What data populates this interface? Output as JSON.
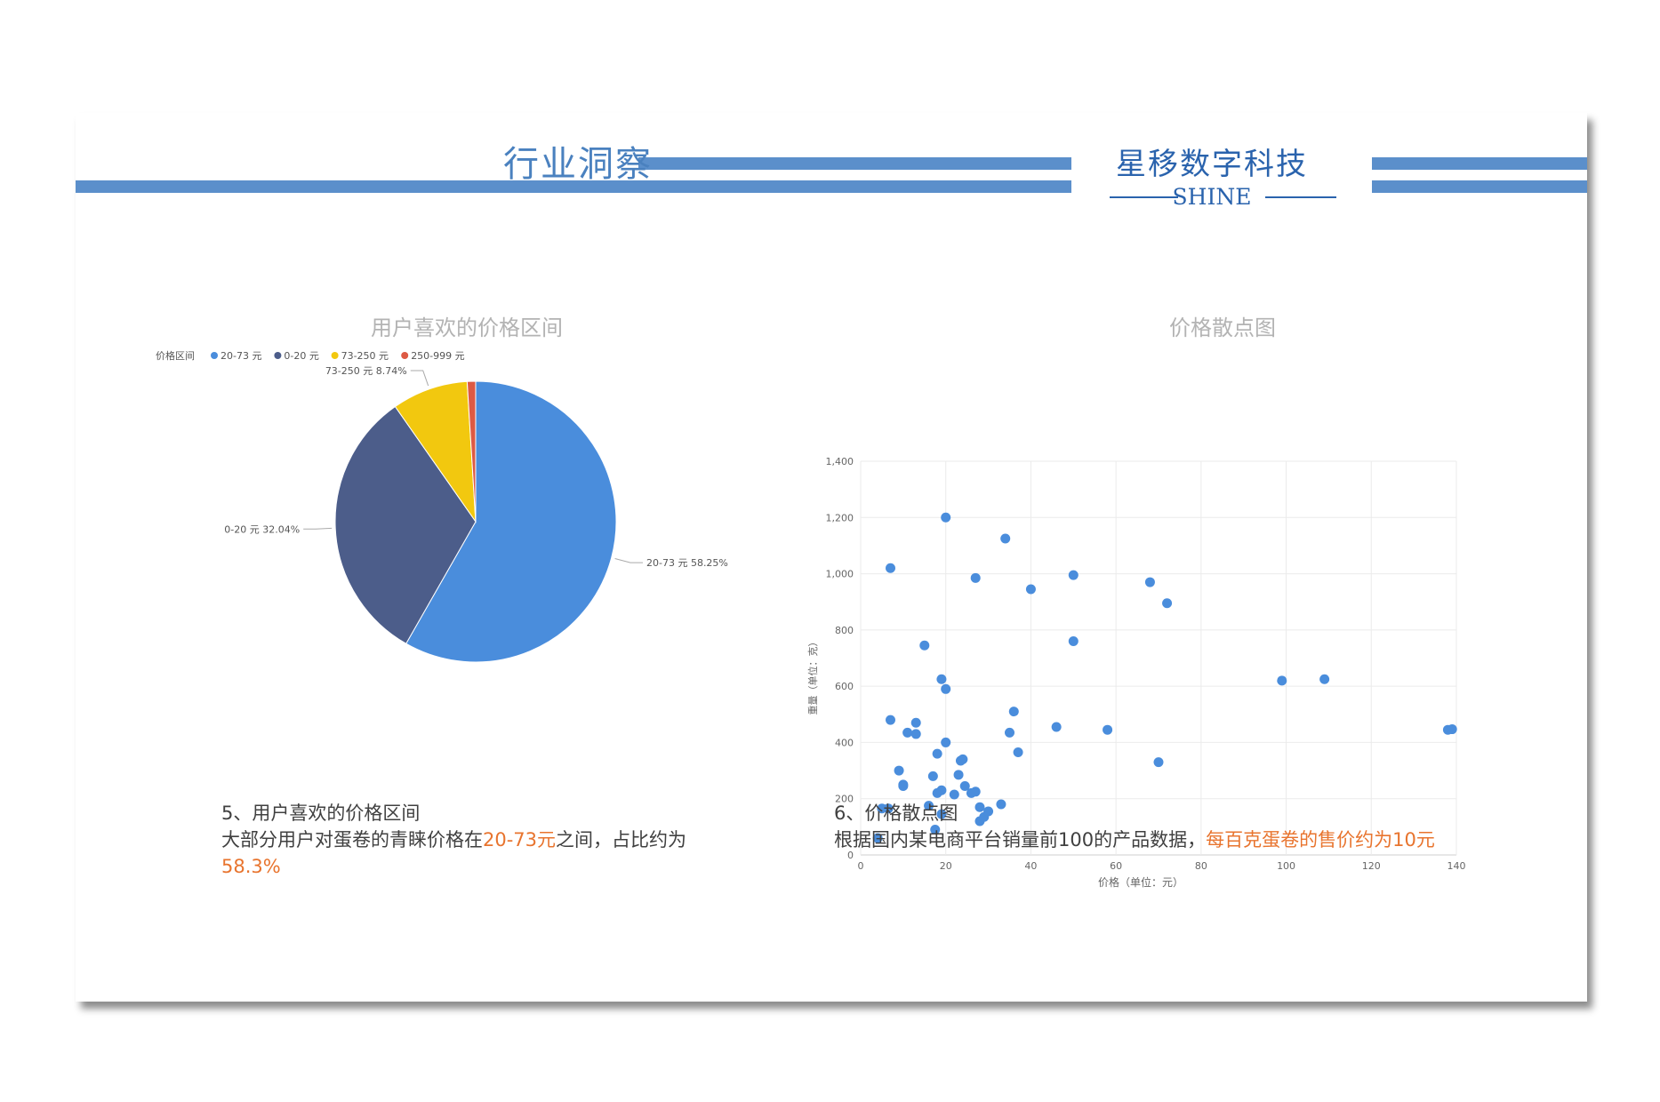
{
  "header": {
    "title": "行业洞察",
    "brand_name": "星移数字科技",
    "brand_sub": "SHINE",
    "accent_color": "#5b8fcb"
  },
  "left_panel": {
    "caption_title": "5、用户喜欢的价格区间",
    "caption_text_1": "大部分用户对蛋卷的青睐价格在",
    "caption_highlight_1": "20-73元",
    "caption_text_2": "之间，占比约为",
    "caption_highlight_2": "58.3%"
  },
  "right_panel": {
    "caption_title": "6、价格散点图",
    "caption_text_1": "根据国内某电商平台销量前100的产品数据，",
    "caption_highlight_1": "每百克蛋卷的售价约为10元"
  },
  "chart_data": [
    {
      "type": "pie",
      "title": "用户喜欢的价格区间",
      "legend_title": "价格区间",
      "legend_position": "top-left",
      "slices": [
        {
          "label": "20-73 元",
          "value": 58.25,
          "display": "20-73 元 58.25%",
          "color": "#4a8ddc"
        },
        {
          "label": "0-20 元",
          "value": 32.04,
          "display": "0-20 元 32.04%",
          "color": "#4c5d8a"
        },
        {
          "label": "73-250 元",
          "value": 8.74,
          "display": "73-250 元 8.74%",
          "color": "#f2c80f"
        },
        {
          "label": "250-999 元",
          "value": 0.97,
          "display": "",
          "color": "#dd5a44"
        }
      ]
    },
    {
      "type": "scatter",
      "title": "价格散点图",
      "xlabel": "价格（单位：元）",
      "ylabel": "重量（单位：克）",
      "xlim": [
        0,
        140
      ],
      "ylim": [
        0,
        1400
      ],
      "xticks": [
        "0",
        "20",
        "40",
        "60",
        "80",
        "100",
        "120",
        "140"
      ],
      "yticks": [
        "0",
        "200",
        "400",
        "600",
        "800",
        "1,000",
        "1,200",
        "1,400"
      ],
      "grid": true,
      "point_color": "#4a8ddc",
      "points": [
        [
          4,
          60
        ],
        [
          5,
          165
        ],
        [
          6.5,
          165
        ],
        [
          7,
          1020
        ],
        [
          7,
          480
        ],
        [
          9,
          300
        ],
        [
          10,
          250
        ],
        [
          10,
          245
        ],
        [
          11,
          435
        ],
        [
          13,
          430
        ],
        [
          13,
          470
        ],
        [
          15,
          745
        ],
        [
          16,
          175
        ],
        [
          17,
          280
        ],
        [
          17.5,
          90
        ],
        [
          18,
          220
        ],
        [
          18,
          360
        ],
        [
          19,
          230
        ],
        [
          19,
          145
        ],
        [
          19,
          625
        ],
        [
          20,
          1200
        ],
        [
          20,
          590
        ],
        [
          20,
          400
        ],
        [
          22,
          215
        ],
        [
          23,
          285
        ],
        [
          23.5,
          335
        ],
        [
          24,
          340
        ],
        [
          24.5,
          245
        ],
        [
          26,
          220
        ],
        [
          27,
          225
        ],
        [
          27,
          985
        ],
        [
          28,
          120
        ],
        [
          28,
          170
        ],
        [
          29,
          135
        ],
        [
          30,
          155
        ],
        [
          33,
          180
        ],
        [
          34,
          1125
        ],
        [
          35,
          435
        ],
        [
          36,
          510
        ],
        [
          37,
          365
        ],
        [
          40,
          945
        ],
        [
          46,
          455
        ],
        [
          50,
          995
        ],
        [
          50,
          760
        ],
        [
          58,
          445
        ],
        [
          68,
          970
        ],
        [
          70,
          330
        ],
        [
          72,
          895
        ],
        [
          99,
          620
        ],
        [
          109,
          625
        ],
        [
          138,
          445
        ],
        [
          139,
          447
        ]
      ]
    }
  ]
}
